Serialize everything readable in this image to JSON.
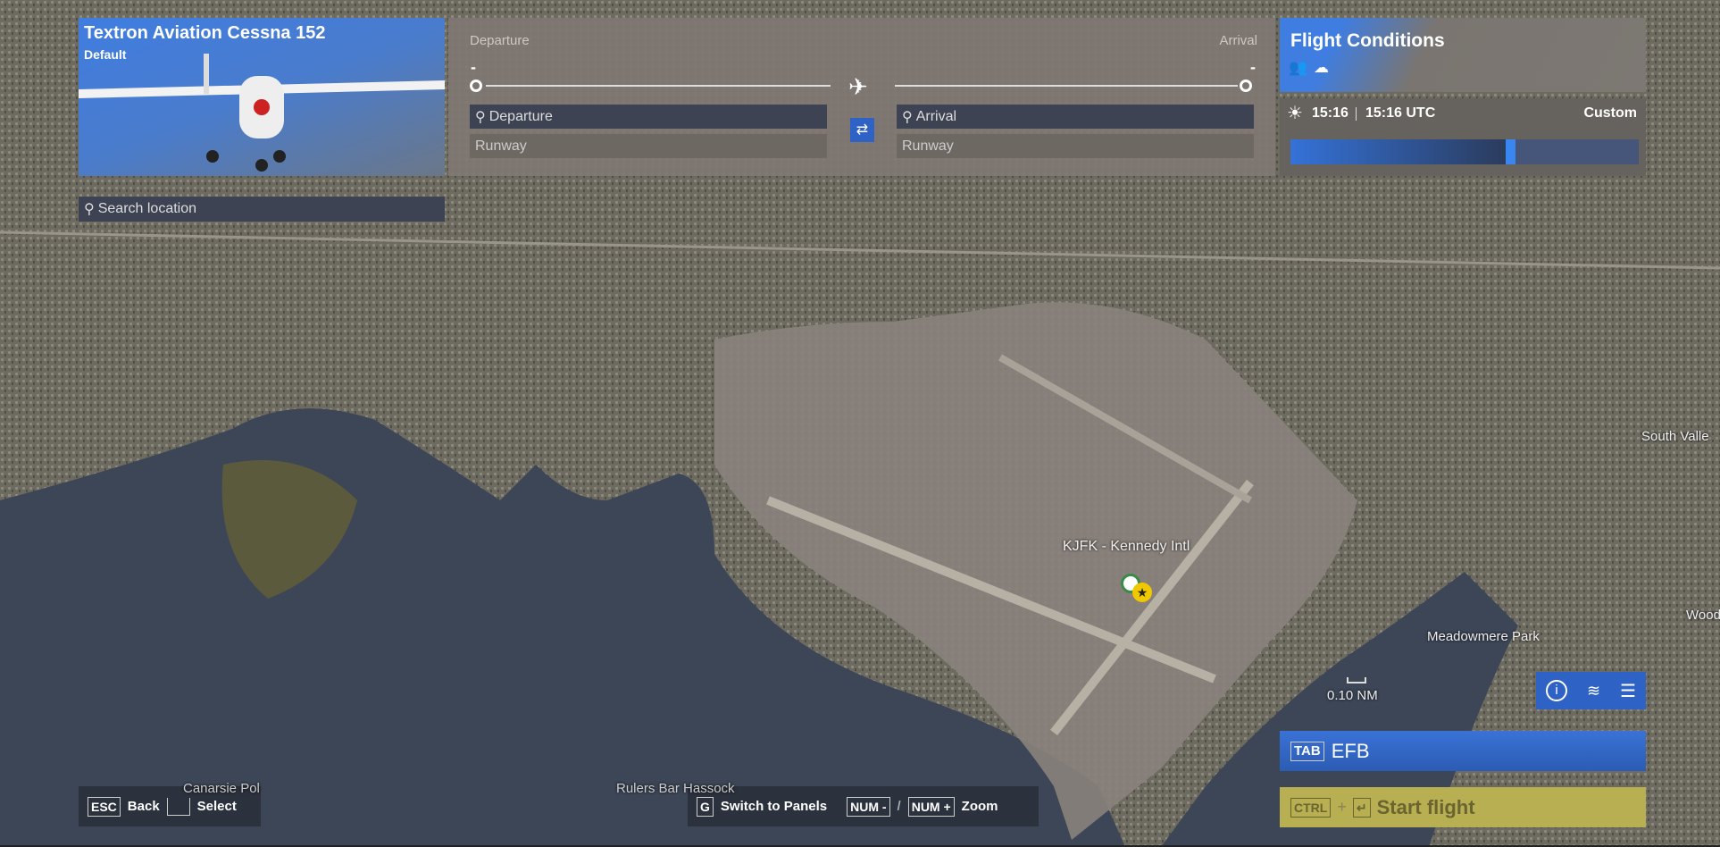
{
  "aircraft": {
    "name": "Textron Aviation Cessna 152",
    "livery": "Default"
  },
  "route": {
    "departure_label": "Departure",
    "arrival_label": "Arrival",
    "departure_value": "-",
    "arrival_value": "-",
    "departure_placeholder": "Departure",
    "arrival_placeholder": "Arrival",
    "departure_runway": "Runway",
    "arrival_runway": "Runway"
  },
  "search": {
    "placeholder": "Search location"
  },
  "conditions": {
    "title": "Flight Conditions",
    "local_time": "15:16",
    "utc_time": "15:16 UTC",
    "mode": "Custom",
    "time_slider_fraction": 0.63
  },
  "map": {
    "airport_label": "KJFK - Kennedy Intl",
    "scale": "0.10 NM",
    "places": [
      "South Valle",
      "Meadowmere Park",
      "Wood",
      "Canarsie Pol",
      "Rulers Bar Hassock"
    ]
  },
  "buttons": {
    "efb_key": "TAB",
    "efb": "EFB",
    "start_key1": "CTRL",
    "plus": "+",
    "start": "Start flight"
  },
  "hints": {
    "esc_key": "ESC",
    "back": "Back",
    "select": "Select",
    "g_key": "G",
    "switch": "Switch to Panels",
    "num_minus": "NUM -",
    "slash": "/",
    "num_plus": "NUM +",
    "zoom": "Zoom"
  },
  "colors": {
    "accent": "#2e62c4",
    "start": "#b8ae52"
  }
}
